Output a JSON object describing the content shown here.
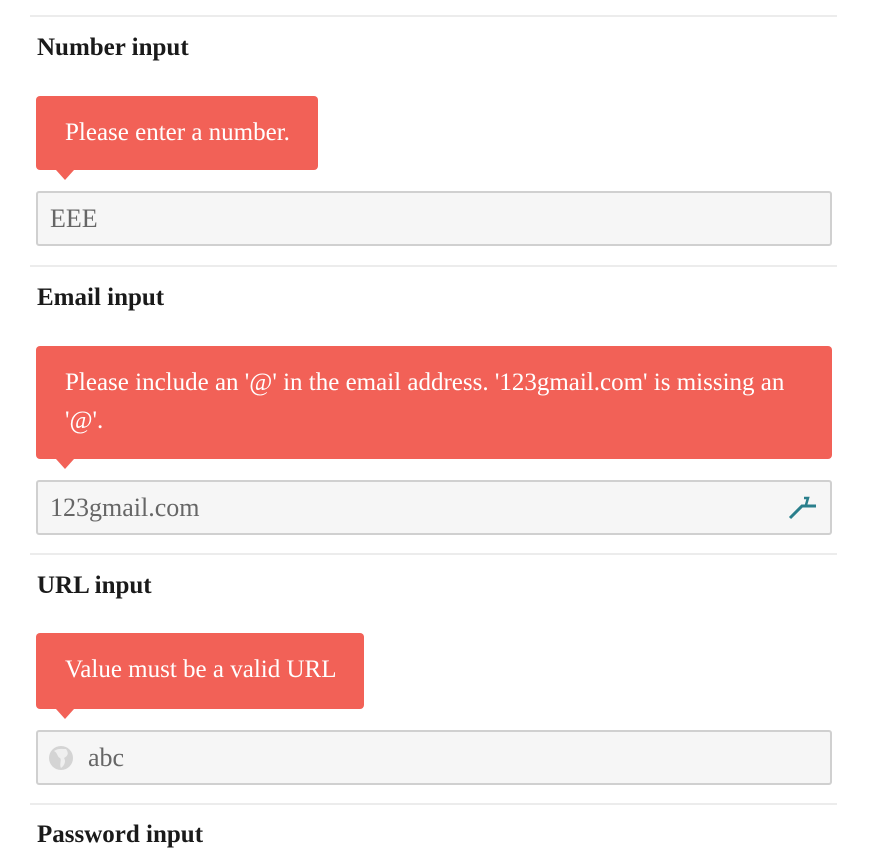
{
  "sections": [
    {
      "heading": "Number input",
      "error": "Please enter a number.",
      "value": "EEE",
      "type": "number"
    },
    {
      "heading": "Email input",
      "error": "Please include an '@' in the email address. '123gmail.com' is missing an '@'.",
      "value": "123gmail.com",
      "type": "email",
      "trailing_icon": "autofill-icon"
    },
    {
      "heading": "URL input",
      "error": "Value must be a valid URL",
      "value": "abc",
      "type": "url",
      "leading_icon": "globe-icon"
    },
    {
      "heading": "Password input"
    }
  ],
  "colors": {
    "error_bg": "#f26157",
    "input_bg": "#f6f6f6",
    "input_border": "#d0d0d0",
    "divider": "#ececec"
  }
}
